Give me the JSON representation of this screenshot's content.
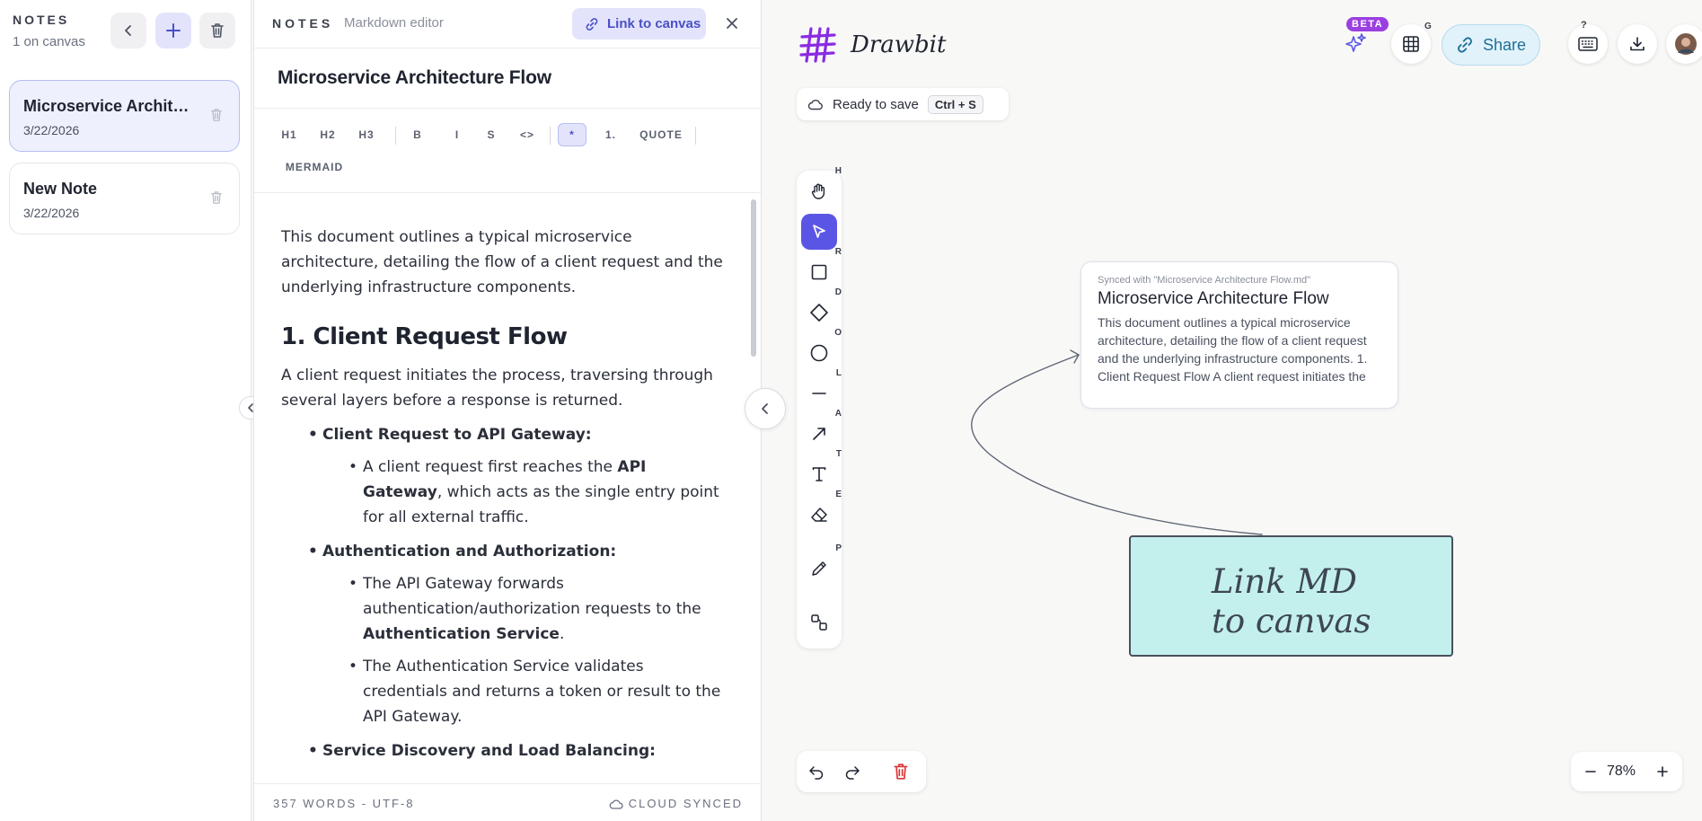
{
  "notes_panel": {
    "title": "NOTES",
    "count": "1 on canvas",
    "notes": [
      {
        "title": "Microservice Architecture Flow",
        "date": "3/22/2026"
      },
      {
        "title": "New Note",
        "date": "3/22/2026"
      }
    ]
  },
  "editor": {
    "label": "NOTES",
    "kind": "Markdown editor",
    "link_button": "Link to canvas",
    "doc_title": "Microservice Architecture Flow",
    "toolbar": [
      "H1",
      "H2",
      "H3",
      "B",
      "I",
      "S",
      "<>",
      "*",
      "1.",
      "QUOTE",
      "MERMAID"
    ],
    "intro": "This document outlines a typical microservice architecture, detailing the flow of a client request and the underlying infrastructure components.",
    "heading": "1. Client Request Flow",
    "para": "A client request initiates the process, traversing through several layers before a response is returned.",
    "items": [
      {
        "title": "Client Request to API Gateway:",
        "sub": [
          {
            "before": "A client request first reaches the ",
            "bold": "API Gateway",
            "after": ", which acts as the single entry point for all external traffic."
          }
        ]
      },
      {
        "title": "Authentication and Authorization:",
        "sub": [
          {
            "before": "The API Gateway forwards authentication/authorization requests to the ",
            "bold": "Authentication Service",
            "after": "."
          },
          {
            "before": "The Authentication Service validates credentials and returns a token or result to the API Gateway.",
            "bold": "",
            "after": ""
          }
        ]
      },
      {
        "title": "Service Discovery and Load Balancing:",
        "sub": []
      }
    ],
    "footer_words": "357 WORDS - UTF-8",
    "footer_sync": "CLOUD SYNCED"
  },
  "canvas": {
    "brand": "Drawbit",
    "save_status": "Ready to save",
    "save_shortcut": "Ctrl + S",
    "beta_badge": "BETA",
    "grid_key": "G",
    "help_key": "?",
    "share": "Share",
    "tools": [
      {
        "name": "hand-tool",
        "key": "H"
      },
      {
        "name": "select-tool",
        "key": ""
      },
      {
        "name": "rectangle-tool",
        "key": "R"
      },
      {
        "name": "diamond-tool",
        "key": "D"
      },
      {
        "name": "ellipse-tool",
        "key": "O"
      },
      {
        "name": "line-tool",
        "key": "L"
      },
      {
        "name": "arrow-tool",
        "key": "A"
      },
      {
        "name": "text-tool",
        "key": "T"
      },
      {
        "name": "eraser-tool",
        "key": "E"
      },
      {
        "name": "pencil-tool",
        "key": "P"
      },
      {
        "name": "shapes-library-tool",
        "key": ""
      }
    ],
    "note_card": {
      "synced": "Synced with \"Microservice Architecture Flow.md\"",
      "title": "Microservice Architecture Flow",
      "excerpt": "This document outlines a typical microservice architecture, detailing the flow of a client request and the underlying infrastructure components. 1. Client Request Flow A client request initiates the process, traversing through"
    },
    "sticky_text": "Link MD\nto canvas",
    "zoom": "78%",
    "colors": {
      "accent": "#5b55e6",
      "sticky": "#c3f0ec",
      "share": "#1e6f96",
      "beta": "#9a3fe0",
      "delete": "#d93636"
    }
  }
}
